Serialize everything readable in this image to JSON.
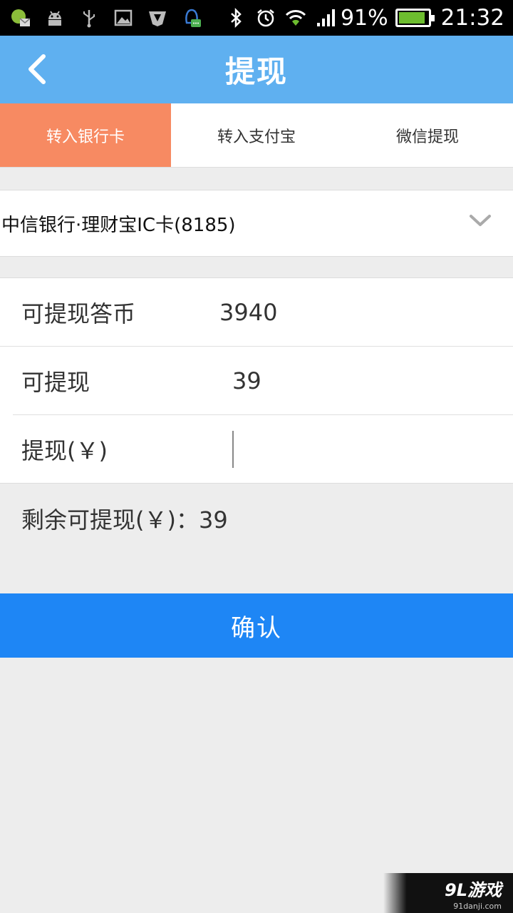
{
  "status_bar": {
    "battery_percent": "91%",
    "battery_level": 0.91,
    "time": "21:32",
    "icons_left": [
      "app-notification-icon",
      "android-icon",
      "usb-icon",
      "image-icon",
      "shield-app-icon",
      "qq-icon"
    ],
    "icons_right": [
      "bluetooth-icon",
      "alarm-icon",
      "wifi-icon",
      "signal-icon"
    ]
  },
  "header": {
    "title": "提现"
  },
  "tabs": [
    {
      "label": "转入银行卡",
      "active": true
    },
    {
      "label": "转入支付宝",
      "active": false
    },
    {
      "label": "微信提现",
      "active": false
    }
  ],
  "bank_select": {
    "selected": "中信银行·理财宝IC卡(8185)"
  },
  "form": {
    "coins_label": "可提现答币",
    "coins_value": "3940",
    "available_label": "可提现",
    "available_value": "39",
    "amount_label": "提现(￥)",
    "amount_value": ""
  },
  "remaining": {
    "text": "剩余可提现(￥)：39"
  },
  "confirm": {
    "label": "确认"
  },
  "watermark": {
    "logo": "9L游戏",
    "url": "91danji.com"
  },
  "colors": {
    "header_bg": "#5fb0f0",
    "active_tab_bg": "#f78a62",
    "confirm_bg": "#1e86f5",
    "page_bg": "#ededed"
  }
}
